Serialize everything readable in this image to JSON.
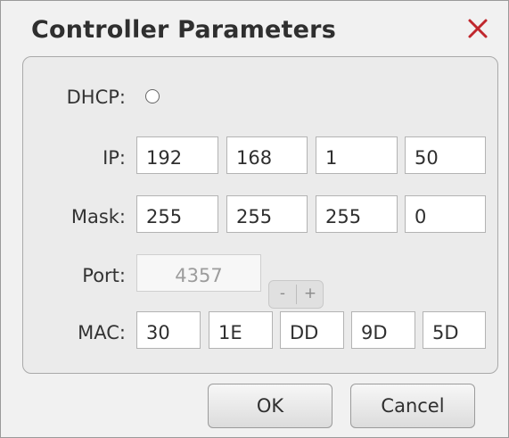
{
  "dialog": {
    "title": "Controller Parameters",
    "close_icon": "close-icon",
    "accent": "#c0272d"
  },
  "dhcp": {
    "label": "DHCP:",
    "checked": false
  },
  "ip": {
    "label": "IP:",
    "octets": [
      "192",
      "168",
      "1",
      "50"
    ]
  },
  "mask": {
    "label": "Mask:",
    "octets": [
      "255",
      "255",
      "255",
      "0"
    ]
  },
  "port": {
    "label": "Port:",
    "value": "4357",
    "decrement_label": "-",
    "increment_label": "+"
  },
  "mac": {
    "label": "MAC:",
    "bytes": [
      "30",
      "1E",
      "DD",
      "9D",
      "5D"
    ]
  },
  "buttons": {
    "ok": "OK",
    "cancel": "Cancel"
  }
}
